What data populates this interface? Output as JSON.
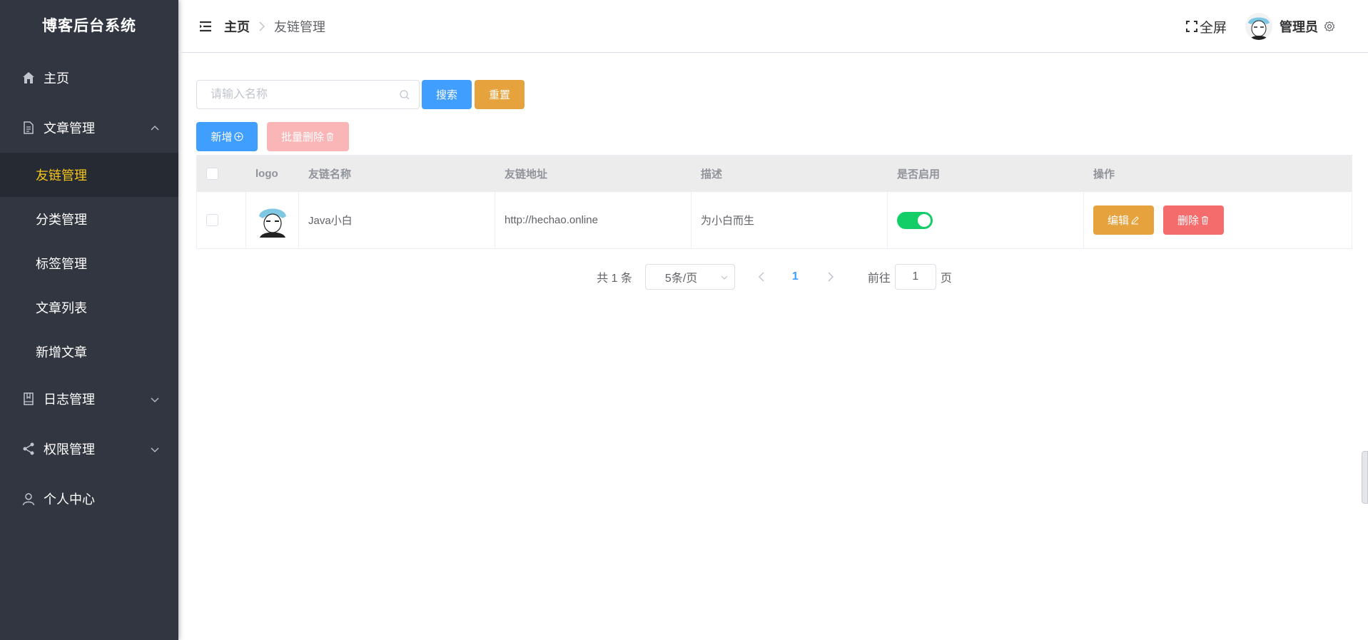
{
  "app_title": "博客后台系统",
  "sidebar": {
    "items": [
      {
        "label": "主页",
        "icon": "home-icon"
      },
      {
        "label": "文章管理",
        "icon": "document-icon",
        "expanded": true
      },
      {
        "label": "日志管理",
        "icon": "book-icon"
      },
      {
        "label": "权限管理",
        "icon": "share-icon"
      },
      {
        "label": "个人中心",
        "icon": "user-icon"
      }
    ],
    "sub_items": [
      "友链管理",
      "分类管理",
      "标签管理",
      "文章列表",
      "新增文章"
    ],
    "active_sub": "友链管理"
  },
  "header": {
    "breadcrumb_home": "主页",
    "breadcrumb_current": "友链管理",
    "fullscreen_label": "全屏",
    "username": "管理员"
  },
  "search": {
    "placeholder": "请输入名称",
    "search_label": "搜索",
    "reset_label": "重置"
  },
  "toolbar": {
    "add_label": "新增",
    "batch_delete_label": "批量删除"
  },
  "table": {
    "columns": [
      "logo",
      "友链名称",
      "友链地址",
      "描述",
      "是否启用",
      "操作"
    ],
    "rows": [
      {
        "name": "Java小白",
        "url": "http://hechao.online",
        "desc": "为小白而生",
        "enabled": true,
        "edit_label": "编辑",
        "delete_label": "删除"
      }
    ]
  },
  "pagination": {
    "total_text": "共 1 条",
    "page_size": "5条/页",
    "current_page": "1",
    "goto_prefix": "前往",
    "goto_value": "1",
    "goto_suffix": "页"
  },
  "colors": {
    "sidebar_bg": "#323641",
    "active_text": "#f5c518",
    "primary": "#409eff",
    "warning": "#e6a23c",
    "danger": "#f56c6c",
    "success": "#13ce66"
  }
}
